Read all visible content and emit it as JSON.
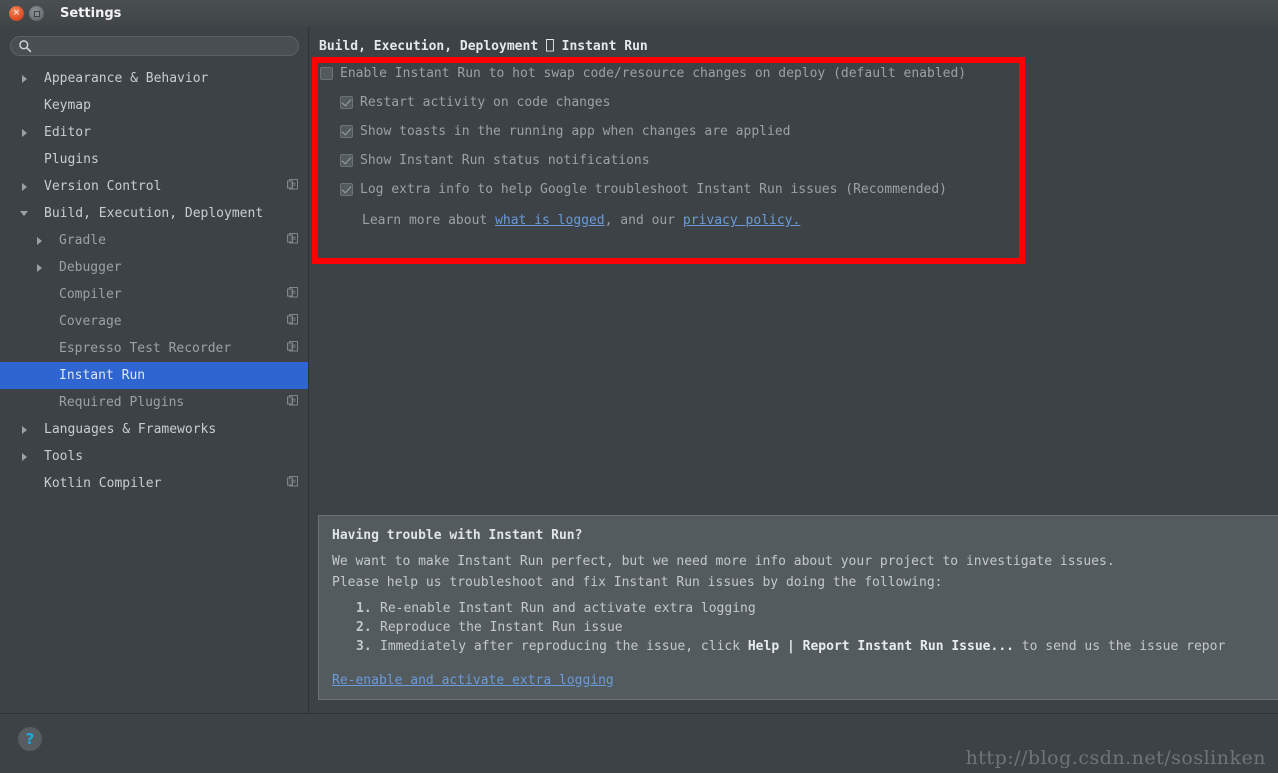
{
  "window": {
    "title": "Settings",
    "close_label": "×",
    "maximize_label": ""
  },
  "search": {
    "value": "",
    "placeholder": ""
  },
  "sidebar": {
    "items": [
      {
        "label": "Appearance & Behavior",
        "level": 0,
        "arrow": "right",
        "project_icon": false,
        "selected": false
      },
      {
        "label": "Keymap",
        "level": 0,
        "arrow": "none",
        "project_icon": false,
        "selected": false
      },
      {
        "label": "Editor",
        "level": 0,
        "arrow": "right",
        "project_icon": false,
        "selected": false
      },
      {
        "label": "Plugins",
        "level": 0,
        "arrow": "none",
        "project_icon": false,
        "selected": false
      },
      {
        "label": "Version Control",
        "level": 0,
        "arrow": "right",
        "project_icon": true,
        "selected": false
      },
      {
        "label": "Build, Execution, Deployment",
        "level": 0,
        "arrow": "down",
        "project_icon": false,
        "selected": false
      },
      {
        "label": "Gradle",
        "level": 1,
        "arrow": "right",
        "project_icon": true,
        "selected": false
      },
      {
        "label": "Debugger",
        "level": 1,
        "arrow": "right",
        "project_icon": false,
        "selected": false
      },
      {
        "label": "Compiler",
        "level": 1,
        "arrow": "none",
        "project_icon": true,
        "selected": false
      },
      {
        "label": "Coverage",
        "level": 1,
        "arrow": "none",
        "project_icon": true,
        "selected": false
      },
      {
        "label": "Espresso Test Recorder",
        "level": 1,
        "arrow": "none",
        "project_icon": true,
        "selected": false
      },
      {
        "label": "Instant Run",
        "level": 1,
        "arrow": "none",
        "project_icon": false,
        "selected": true
      },
      {
        "label": "Required Plugins",
        "level": 1,
        "arrow": "none",
        "project_icon": true,
        "selected": false
      },
      {
        "label": "Languages & Frameworks",
        "level": 0,
        "arrow": "right",
        "project_icon": false,
        "selected": false
      },
      {
        "label": "Tools",
        "level": 0,
        "arrow": "right",
        "project_icon": false,
        "selected": false
      },
      {
        "label": "Kotlin Compiler",
        "level": 0,
        "arrow": "none",
        "project_icon": true,
        "selected": false
      }
    ]
  },
  "main": {
    "breadcrumb": "Build, Execution, Deployment ⎕ Instant Run",
    "options": [
      {
        "label": "Enable Instant Run to hot swap code/resource changes on deploy (default enabled)",
        "checked": false,
        "sub": false
      },
      {
        "label": "Restart activity on code changes",
        "checked": true,
        "sub": true
      },
      {
        "label": "Show toasts in the running app when changes are applied",
        "checked": true,
        "sub": true
      },
      {
        "label": "Show Instant Run status notifications",
        "checked": true,
        "sub": true
      },
      {
        "label": "Log extra info to help Google troubleshoot Instant Run issues (Recommended)",
        "checked": true,
        "sub": true
      }
    ],
    "learn_more": {
      "prefix": "Learn more about ",
      "link1": "what is logged",
      "middle": ", and our ",
      "link2": "privacy policy."
    }
  },
  "annotation": {
    "highlight_color": "#ff0000"
  },
  "trouble": {
    "title": "Having trouble with Instant Run?",
    "paragraph1": "We want to make Instant Run perfect, but we need more info about your project to investigate issues.",
    "paragraph2": "Please help us troubleshoot and fix Instant Run issues by doing the following:",
    "steps": [
      {
        "num": "1.",
        "text_before": "Re-enable Instant Run and activate extra logging",
        "bold": "",
        "text_after": ""
      },
      {
        "num": "2.",
        "text_before": "Reproduce the Instant Run issue",
        "bold": "",
        "text_after": ""
      },
      {
        "num": "3.",
        "text_before": "Immediately after reproducing the issue, click ",
        "bold": "Help | Report Instant Run Issue...",
        "text_after": " to send us the issue repor"
      }
    ],
    "bottom_link": "Re-enable and activate extra logging"
  },
  "footer": {
    "help_label": "?",
    "watermark": "http://blog.csdn.net/soslinken"
  }
}
